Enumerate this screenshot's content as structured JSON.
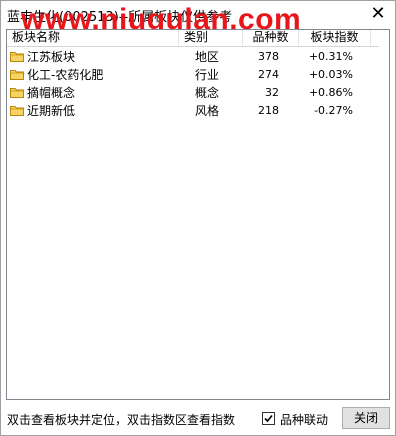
{
  "window": {
    "title": "蓝丰生化(002513)--所属板块仅供参考",
    "watermark": "www.niugulan.com",
    "close_glyph": "✕"
  },
  "table": {
    "columns": [
      "板块名称",
      "类别",
      "品种数",
      "板块指数"
    ],
    "rows": [
      {
        "name": "江苏板块",
        "type": "地区",
        "count": "378",
        "change": "+0.31%"
      },
      {
        "name": "化工-农药化肥",
        "type": "行业",
        "count": "274",
        "change": "+0.03%"
      },
      {
        "name": "摘帽概念",
        "type": "概念",
        "count": "32",
        "change": "+0.86%"
      },
      {
        "name": "近期新低",
        "type": "风格",
        "count": "218",
        "change": "-0.27%"
      }
    ]
  },
  "footer": {
    "hint": "双击查看板块并定位，双击指数区查看指数",
    "checkbox_label": "品种联动",
    "checkbox_checked": true,
    "close_label": "关闭"
  }
}
